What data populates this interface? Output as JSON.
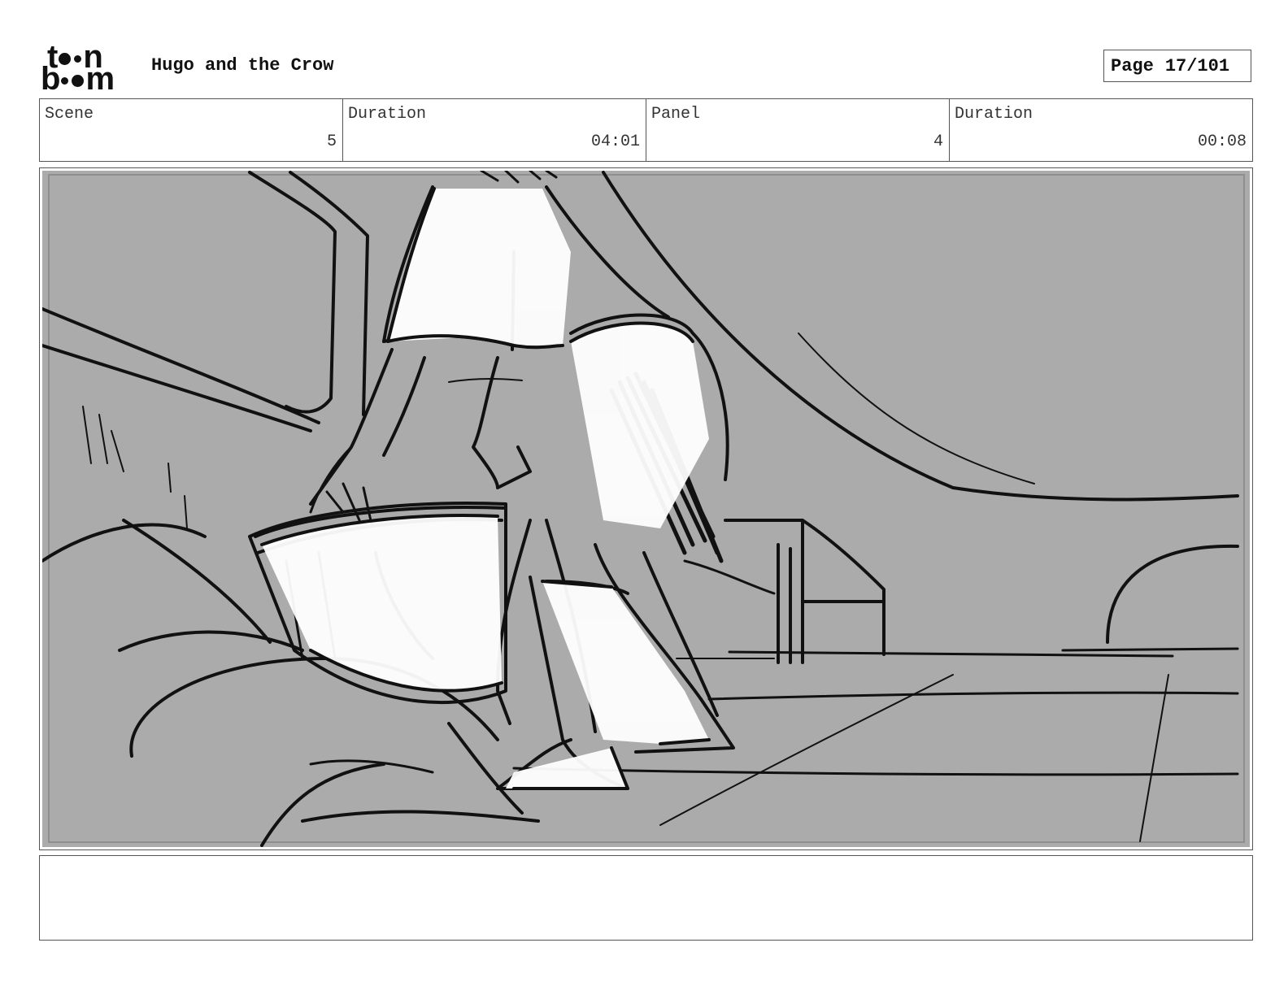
{
  "header": {
    "logo_text": "toon boom",
    "project_title": "Hugo and the Crow",
    "page_label": "Page",
    "page_number": "17/101"
  },
  "info": {
    "scene_label": "Scene",
    "scene_value": "5",
    "scene_duration_label": "Duration",
    "scene_duration_value": "04:01",
    "panel_label": "Panel",
    "panel_value": "4",
    "panel_duration_label": "Duration",
    "panel_duration_value": "00:08"
  },
  "notes": {
    "text": ""
  }
}
